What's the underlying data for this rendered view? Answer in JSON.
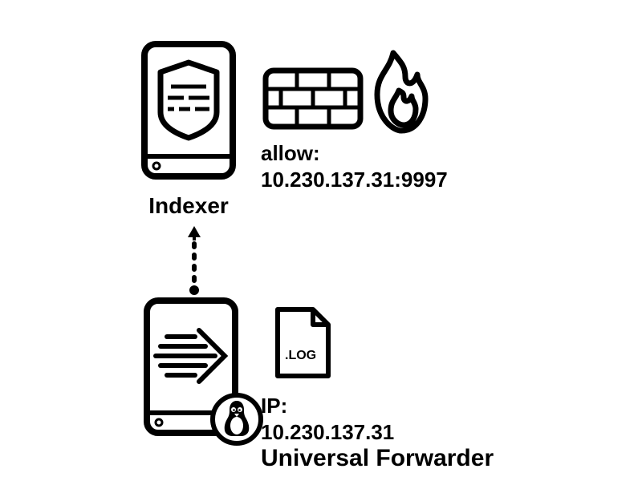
{
  "indexer": {
    "label": "Indexer"
  },
  "firewall": {
    "allow_label": "allow:",
    "allow_value": "10.230.137.31:9997"
  },
  "forwarder": {
    "label": "Universal Forwarder",
    "ip_label": "IP:",
    "ip_value": "10.230.137.31",
    "log_badge": ".LOG",
    "os": "linux"
  }
}
